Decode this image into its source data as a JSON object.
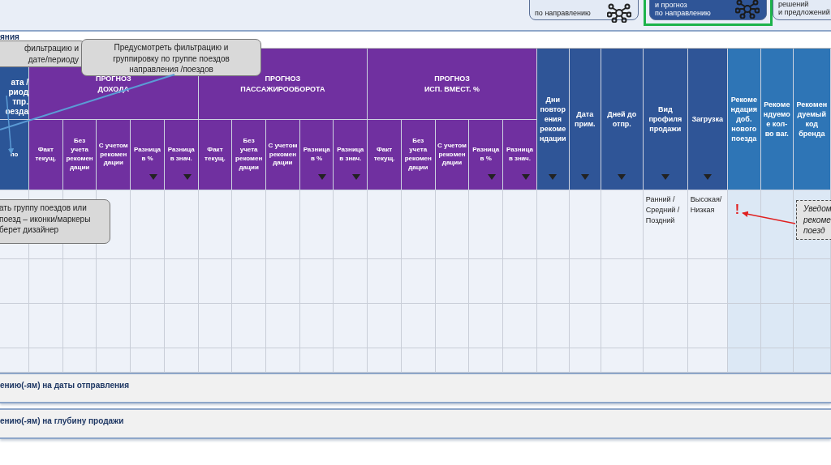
{
  "nav_buttons": [
    {
      "lines": [
        "по направлению"
      ],
      "selected": false
    },
    {
      "lines": [
        "и прогноз",
        "по направлению"
      ],
      "selected": true
    },
    {
      "lines": [
        "решений",
        "и предложений"
      ],
      "selected": false
    }
  ],
  "section_title": "яния",
  "table": {
    "groups": [
      {
        "kind": "lead",
        "lines": [
          "ата /",
          "риод",
          "тпр.",
          "оезда"
        ],
        "columns": [
          {
            "label": "по",
            "filter": false
          }
        ]
      },
      {
        "kind": "purple",
        "lines": [
          "ПРОГНОЗ",
          "ДОХОДА"
        ],
        "columns": [
          {
            "label": "Факт текущ.",
            "filter": false
          },
          {
            "label": "Без учета рекомендации",
            "filter": false
          },
          {
            "label": "С учетом рекомендации",
            "filter": false
          },
          {
            "label": "Разница в %",
            "filter": true
          },
          {
            "label": "Разница в знач.",
            "filter": true
          }
        ]
      },
      {
        "kind": "purple",
        "lines": [
          "ПРОГНОЗ",
          "ПАССАЖИРООБОРОТА"
        ],
        "columns": [
          {
            "label": "Факт текущ.",
            "filter": false
          },
          {
            "label": "Без учета рекомендации",
            "filter": false
          },
          {
            "label": "С учетом рекомендации",
            "filter": false
          },
          {
            "label": "Разница в %",
            "filter": true
          },
          {
            "label": "Разница в знач.",
            "filter": true
          }
        ]
      },
      {
        "kind": "purple",
        "lines": [
          "ПРОГНОЗ",
          "ИСП. ВМЕСТ. %"
        ],
        "columns": [
          {
            "label": "Факт текущ.",
            "filter": false
          },
          {
            "label": "Без учета рекомендации",
            "filter": false
          },
          {
            "label": "С учетом рекомендации",
            "filter": false
          },
          {
            "label": "Разница в %",
            "filter": true
          },
          {
            "label": "Разница в знач.",
            "filter": true
          }
        ]
      }
    ],
    "columns": [
      {
        "kind": "navy",
        "label": "Дни повторения рекомендации",
        "filter": true
      },
      {
        "kind": "navy",
        "label": "Дата прим.",
        "filter": true
      },
      {
        "kind": "navy",
        "label": "Дней до отпр.",
        "filter": true
      },
      {
        "kind": "navy",
        "label": "Вид профиля продажи",
        "filter": true
      },
      {
        "kind": "navy",
        "label": "Загрузка",
        "filter": true
      },
      {
        "kind": "blue",
        "label": "Рекомендация доб. нового поезда",
        "filter": false
      },
      {
        "kind": "blue",
        "label": "Рекомендуемое кол-во ваг.",
        "filter": false
      },
      {
        "kind": "blue",
        "label": "Рекомендуемый код бренда",
        "filter": false
      }
    ],
    "rows": [
      {
        "kind": "data",
        "sale_profile": "Ранний / Средний / Поздний",
        "load": "Высокая/ Низкая",
        "alert": "!"
      },
      {
        "kind": "blank"
      },
      {
        "kind": "blank"
      },
      {
        "kind": "blank"
      }
    ]
  },
  "sections": [
    "ению(-ям) на даты отправления",
    "ению(-ям) на глубину продажи"
  ],
  "callouts": [
    {
      "kind": "solid",
      "lines": [
        "фильтрацию и",
        "дате/периоду"
      ]
    },
    {
      "kind": "solid",
      "lines": [
        "Предусмотреть фильтрацию и группировку по группе поездов направления /поездов"
      ]
    },
    {
      "kind": "solid",
      "lines": [
        "ать группу поездов или",
        "поезд – иконки/маркеры",
        "берет дизайнер"
      ]
    },
    {
      "kind": "dashed",
      "lines": [
        "Уведом",
        "рекоме",
        "поезд"
      ]
    }
  ]
}
